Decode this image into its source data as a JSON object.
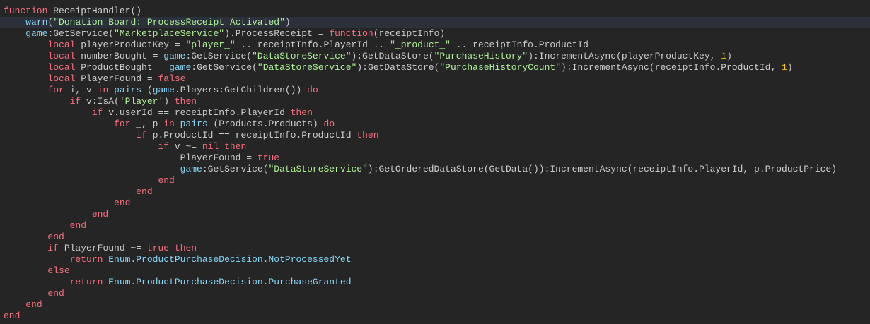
{
  "editor": {
    "highlighted_line": 2,
    "colors": {
      "background": "#252526",
      "keyword": "#f86d7c",
      "string": "#adf195",
      "builtin": "#84d6f7",
      "number": "#ffc600",
      "text": "#cccccc",
      "highlight": "#2b303b"
    },
    "lines": [
      [
        [
          "k",
          "function"
        ],
        [
          "t",
          " ReceiptHandler()"
        ]
      ],
      [
        [
          "t",
          "    "
        ],
        [
          "b",
          "warn"
        ],
        [
          "t",
          "("
        ],
        [
          "s",
          "\"Donation Board: ProcessReceipt Activated\""
        ],
        [
          "t",
          ")"
        ]
      ],
      [
        [
          "t",
          "    "
        ],
        [
          "b",
          "game"
        ],
        [
          "t",
          ":GetService("
        ],
        [
          "s",
          "\"MarketplaceService\""
        ],
        [
          "t",
          ").ProcessReceipt = "
        ],
        [
          "k",
          "function"
        ],
        [
          "t",
          "(receiptInfo)"
        ]
      ],
      [
        [
          "t",
          "        "
        ],
        [
          "k",
          "local"
        ],
        [
          "t",
          " playerProductKey = "
        ],
        [
          "s",
          "\"player_\""
        ],
        [
          "t",
          " .. receiptInfo.PlayerId .. "
        ],
        [
          "s",
          "\"_product_\""
        ],
        [
          "t",
          " .. receiptInfo.ProductId"
        ]
      ],
      [
        [
          "t",
          "        "
        ],
        [
          "k",
          "local"
        ],
        [
          "t",
          " numberBought = "
        ],
        [
          "b",
          "game"
        ],
        [
          "t",
          ":GetService("
        ],
        [
          "s",
          "\"DataStoreService\""
        ],
        [
          "t",
          "):GetDataStore("
        ],
        [
          "s",
          "\"PurchaseHistory\""
        ],
        [
          "t",
          "):IncrementAsync(playerProductKey, "
        ],
        [
          "n",
          "1"
        ],
        [
          "t",
          ")"
        ]
      ],
      [
        [
          "t",
          "        "
        ],
        [
          "k",
          "local"
        ],
        [
          "t",
          " ProductBought = "
        ],
        [
          "b",
          "game"
        ],
        [
          "t",
          ":GetService("
        ],
        [
          "s",
          "\"DataStoreService\""
        ],
        [
          "t",
          "):GetDataStore("
        ],
        [
          "s",
          "\"PurchaseHistoryCount\""
        ],
        [
          "t",
          "):IncrementAsync(receiptInfo.ProductId, "
        ],
        [
          "n",
          "1"
        ],
        [
          "t",
          ")"
        ]
      ],
      [
        [
          "t",
          "        "
        ],
        [
          "k",
          "local"
        ],
        [
          "t",
          " PlayerFound = "
        ],
        [
          "k",
          "false"
        ]
      ],
      [
        [
          "t",
          "        "
        ],
        [
          "k",
          "for"
        ],
        [
          "t",
          " i, v "
        ],
        [
          "k",
          "in"
        ],
        [
          "t",
          " "
        ],
        [
          "b",
          "pairs"
        ],
        [
          "t",
          " ("
        ],
        [
          "b",
          "game"
        ],
        [
          "t",
          ".Players:GetChildren()) "
        ],
        [
          "k",
          "do"
        ]
      ],
      [
        [
          "t",
          "            "
        ],
        [
          "k",
          "if"
        ],
        [
          "t",
          " v:IsA("
        ],
        [
          "s",
          "'Player'"
        ],
        [
          "t",
          ") "
        ],
        [
          "k",
          "then"
        ]
      ],
      [
        [
          "t",
          "                "
        ],
        [
          "k",
          "if"
        ],
        [
          "t",
          " v.userId == receiptInfo.PlayerId "
        ],
        [
          "k",
          "then"
        ]
      ],
      [
        [
          "t",
          "                    "
        ],
        [
          "k",
          "for"
        ],
        [
          "t",
          " _, p "
        ],
        [
          "k",
          "in"
        ],
        [
          "t",
          " "
        ],
        [
          "b",
          "pairs"
        ],
        [
          "t",
          " (Products.Products) "
        ],
        [
          "k",
          "do"
        ]
      ],
      [
        [
          "t",
          "                        "
        ],
        [
          "k",
          "if"
        ],
        [
          "t",
          " p.ProductId == receiptInfo.ProductId "
        ],
        [
          "k",
          "then"
        ]
      ],
      [
        [
          "t",
          "                            "
        ],
        [
          "k",
          "if"
        ],
        [
          "t",
          " v ~= "
        ],
        [
          "k",
          "nil"
        ],
        [
          "t",
          " "
        ],
        [
          "k",
          "then"
        ]
      ],
      [
        [
          "t",
          "                                PlayerFound = "
        ],
        [
          "k",
          "true"
        ]
      ],
      [
        [
          "t",
          "                                "
        ],
        [
          "b",
          "game"
        ],
        [
          "t",
          ":GetService("
        ],
        [
          "s",
          "\"DataStoreService\""
        ],
        [
          "t",
          "):GetOrderedDataStore(GetData()):IncrementAsync(receiptInfo.PlayerId, p.ProductPrice)"
        ]
      ],
      [
        [
          "t",
          "                            "
        ],
        [
          "k",
          "end"
        ]
      ],
      [
        [
          "t",
          "                        "
        ],
        [
          "k",
          "end"
        ]
      ],
      [
        [
          "t",
          "                    "
        ],
        [
          "k",
          "end"
        ]
      ],
      [
        [
          "t",
          "                "
        ],
        [
          "k",
          "end"
        ]
      ],
      [
        [
          "t",
          "            "
        ],
        [
          "k",
          "end"
        ]
      ],
      [
        [
          "t",
          "        "
        ],
        [
          "k",
          "end"
        ]
      ],
      [
        [
          "t",
          "        "
        ],
        [
          "k",
          "if"
        ],
        [
          "t",
          " PlayerFound ~= "
        ],
        [
          "k",
          "true"
        ],
        [
          "t",
          " "
        ],
        [
          "k",
          "then"
        ]
      ],
      [
        [
          "t",
          "            "
        ],
        [
          "k",
          "return"
        ],
        [
          "t",
          " "
        ],
        [
          "b",
          "Enum.ProductPurchaseDecision.NotProcessedYet"
        ]
      ],
      [
        [
          "t",
          "        "
        ],
        [
          "k",
          "else"
        ]
      ],
      [
        [
          "t",
          "            "
        ],
        [
          "k",
          "return"
        ],
        [
          "t",
          " "
        ],
        [
          "b",
          "Enum.ProductPurchaseDecision.PurchaseGranted"
        ]
      ],
      [
        [
          "t",
          "        "
        ],
        [
          "k",
          "end"
        ]
      ],
      [
        [
          "t",
          "    "
        ],
        [
          "k",
          "end"
        ]
      ],
      [
        [
          "k",
          "end"
        ]
      ]
    ]
  }
}
